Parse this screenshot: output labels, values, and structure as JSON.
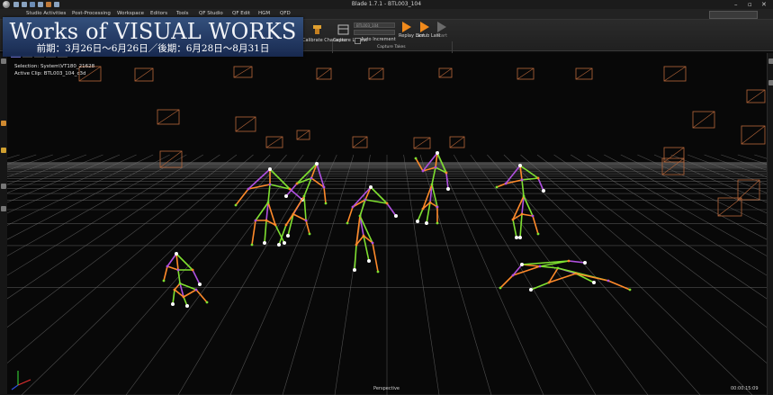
{
  "window": {
    "title": "Blade 1.7.1 - BTL003_104",
    "minimize_glyph": "–",
    "maximize_glyph": "▫",
    "close_glyph": "✕"
  },
  "menu": {
    "items": [
      "Studio Activities",
      "Post-Processing",
      "Workspace",
      "Editors",
      "Tools",
      "QF Studio",
      "QF Edit",
      "HGM",
      "QFD"
    ]
  },
  "ribbon": {
    "calibrate_label": "Calibrate Character",
    "capture_layout_label": "Capture Layout",
    "auto_increment_label": "Auto Increment",
    "replay_label": "Replay Last",
    "scrub_label": "Scrub Last",
    "start_label": "Start",
    "clip_field": "BTL003_104",
    "capture_group_label": "Capture Takes"
  },
  "banner": {
    "title": "Works of VISUAL WORKS",
    "subtitle": "前期：3月26日～6月26日／後期：6月28日～8月31日"
  },
  "viewport": {
    "selection_text": "Selection: System\\VT180_21628",
    "active_clip_text": "Active Clip: BTL003_104_c3d",
    "view_label": "Perspective",
    "time_readout": "00:00:15:09"
  },
  "colors": {
    "grid": "#6e6e6e",
    "camera": "#b8673a",
    "bone_orange": "#ff8a2a",
    "bone_green": "#7fe030",
    "bone_purple": "#b050e0",
    "marker_white": "#ffffff",
    "accent_orange": "#f08a1c"
  }
}
